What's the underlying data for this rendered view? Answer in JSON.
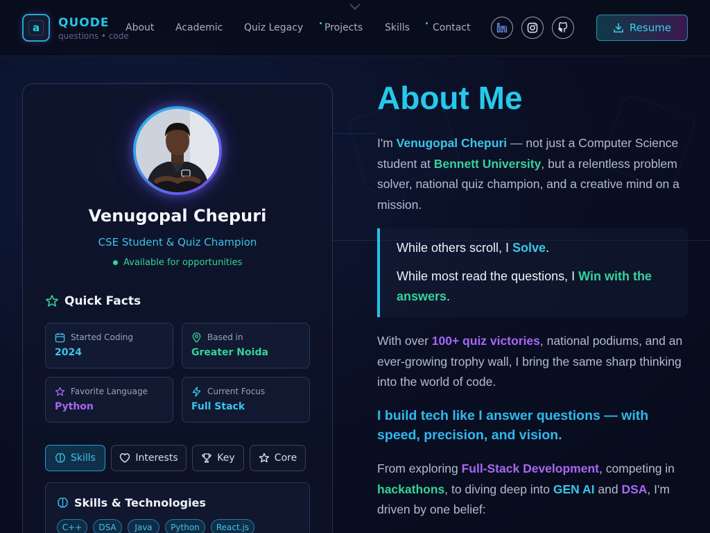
{
  "header": {
    "brand": "QUODE",
    "brand_sub": "questions • code",
    "logo_letter": "a",
    "nav": [
      "About",
      "Academic",
      "Quiz Legacy",
      "Projects",
      "Skills",
      "Contact"
    ],
    "social_icons": [
      "linkedin-icon",
      "instagram-icon",
      "github-icon"
    ],
    "resume_label": "Resume"
  },
  "profile": {
    "name": "Venugopal Chepuri",
    "role": "CSE Student & Quiz Champion",
    "availability": "Available for opportunities",
    "quick_facts_title": "Quick Facts",
    "facts": [
      {
        "label": "Started Coding",
        "value": "2024",
        "icon": "calendar-icon",
        "color": "#3cc4ea"
      },
      {
        "label": "Based in",
        "value": "Greater Noida",
        "icon": "map-pin-icon",
        "color": "#34d399"
      },
      {
        "label": "Favorite Language",
        "value": "Python",
        "icon": "star-icon",
        "color": "#a866f5"
      },
      {
        "label": "Current Focus",
        "value": "Full Stack",
        "icon": "bolt-icon",
        "color": "#3cc4ea"
      }
    ],
    "tabs": [
      "Skills",
      "Interests",
      "Key",
      "Core"
    ],
    "active_tab": "Skills",
    "skills_title": "Skills & Technologies",
    "skills": [
      "C++",
      "DSA",
      "Java",
      "Python",
      "React.js"
    ]
  },
  "about": {
    "title": "About Me",
    "p1": {
      "a": "I'm ",
      "name": "Venugopal Chepuri",
      "b": " — not just a Computer Science student at ",
      "uni": "Bennett University",
      "c": ", but a relentless problem solver, national quiz champion, and a creative mind on a mission."
    },
    "quote": {
      "l1a": "While others scroll, I ",
      "l1b": "Solve",
      "l1c": ".",
      "l2a": "While most read the questions, I ",
      "l2b": "Win with the answers",
      "l2c": "."
    },
    "p2": {
      "a": "With over ",
      "b": "100+ quiz victories",
      "c": ", national podiums, and an ever-growing trophy wall, I bring the same sharp thinking into the world of code."
    },
    "tagline": "I build tech like I answer questions — with speed, precision, and vision.",
    "p3": {
      "a": "From exploring ",
      "b": "Full-Stack Development",
      "c": ", competing in ",
      "d": "hackathons",
      "e": ", to diving deep into ",
      "f": "GEN AI",
      "g": " and ",
      "h": "DSA",
      "i": ", I'm driven by one belief:"
    }
  }
}
